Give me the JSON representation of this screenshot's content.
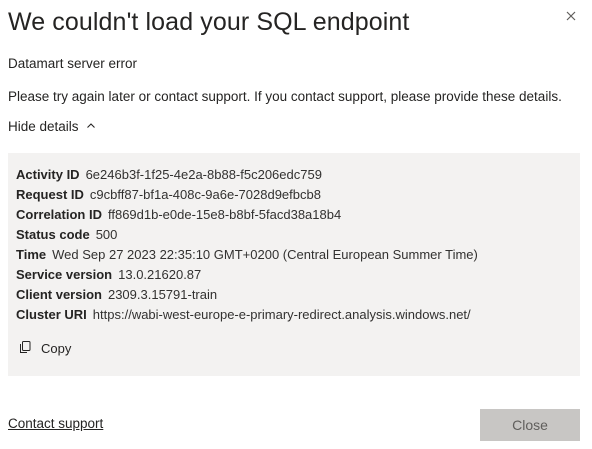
{
  "dialog": {
    "title": "We couldn't load your SQL endpoint",
    "subtitle": "Datamart server error",
    "message": "Please try again later or contact support. If you contact support, please provide these details.",
    "toggle_label": "Hide details",
    "details": [
      {
        "key": "Activity ID",
        "value": "6e246b3f-1f25-4e2a-8b88-f5c206edc759"
      },
      {
        "key": "Request ID",
        "value": "c9cbff87-bf1a-408c-9a6e-7028d9efbcb8"
      },
      {
        "key": "Correlation ID",
        "value": "ff869d1b-e0de-15e8-b8bf-5facd38a18b4"
      },
      {
        "key": "Status code",
        "value": "500"
      },
      {
        "key": "Time",
        "value": "Wed Sep 27 2023 22:35:10 GMT+0200 (Central European Summer Time)"
      },
      {
        "key": "Service version",
        "value": "13.0.21620.87"
      },
      {
        "key": "Client version",
        "value": "2309.3.15791-train"
      },
      {
        "key": "Cluster URI",
        "value": "https://wabi-west-europe-e-primary-redirect.analysis.windows.net/"
      }
    ],
    "copy_label": "Copy",
    "contact_link": "Contact support",
    "close_button": "Close"
  },
  "icons": {
    "close": "close-icon",
    "toggle": "chevron-up-icon",
    "copy": "copy-icon"
  },
  "colors": {
    "details_background": "#f3f2f1",
    "close_button_background": "#c8c6c4",
    "text": "#252423"
  }
}
